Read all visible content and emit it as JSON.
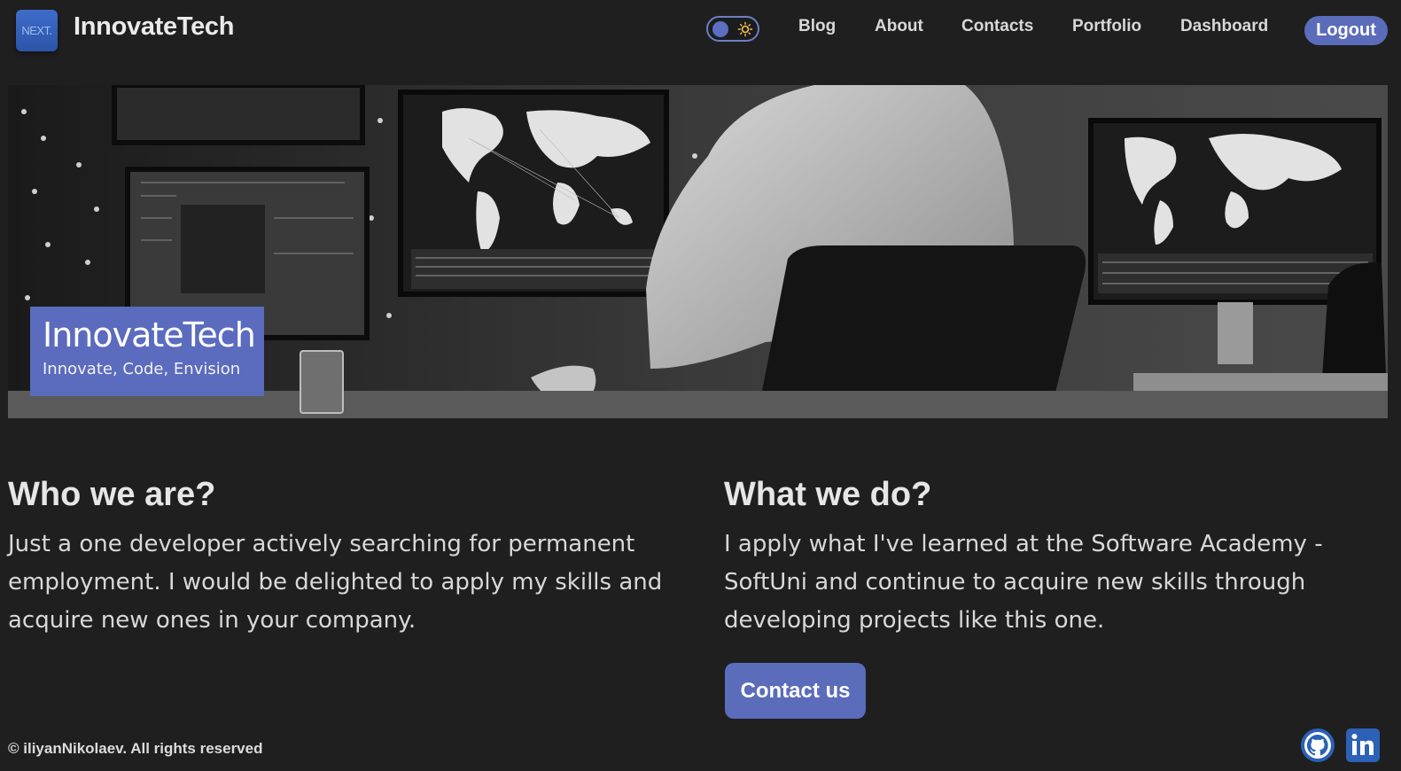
{
  "navbar": {
    "logo_text": "NEXT.",
    "brand": "InnovateTech",
    "links": [
      "Blog",
      "About",
      "Contacts",
      "Portfolio",
      "Dashboard"
    ],
    "logout": "Logout",
    "theme_toggle_icons": [
      "moon-knob",
      "sun-icon"
    ]
  },
  "hero": {
    "image": "grayscale photo of a man at a desk facing multiple monitors with world maps and code",
    "title": "InnovateTech",
    "subtitle": "Innovate, Code, Envision"
  },
  "who": {
    "heading": "Who we are?",
    "text": "Just a one developer actively searching for permanent employment. I would be delighted to apply my skills and acquire new ones in your company."
  },
  "what": {
    "heading": "What we do?",
    "text": "I apply what I've learned at the Software Academy - SoftUni and continue to acquire new skills through developing projects like this one.",
    "button": "Contact us"
  },
  "footer": {
    "copyright": "© iliyanNikolaev. All rights reserved",
    "social": [
      "github-icon",
      "linkedin-icon"
    ]
  },
  "colors": {
    "background": "#1f1f20",
    "accent": "#5b6cbb",
    "text": "#e6e6e6"
  }
}
